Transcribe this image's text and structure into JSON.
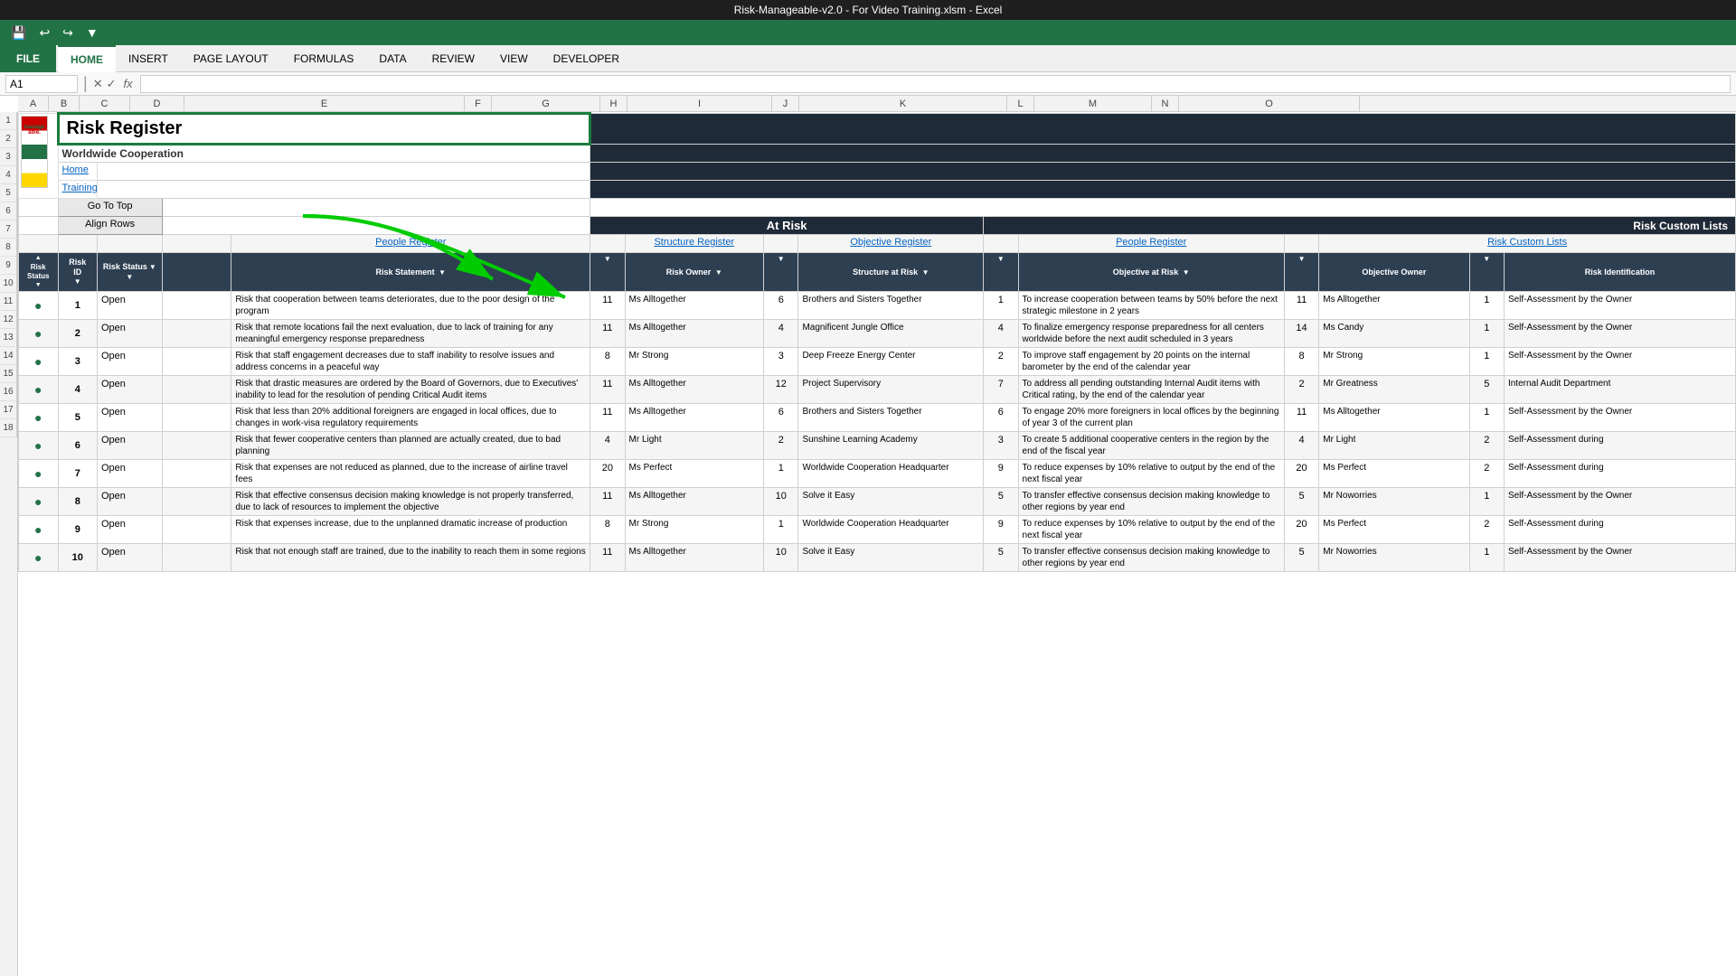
{
  "titleBar": {
    "text": "Risk-Manageable-v2.0 - For Video Training.xlsm - Excel"
  },
  "ribbon": {
    "tabs": [
      "FILE",
      "HOME",
      "INSERT",
      "PAGE LAYOUT",
      "FORMULAS",
      "DATA",
      "REVIEW",
      "VIEW",
      "DEVELOPER"
    ],
    "activeTab": "HOME"
  },
  "formulaBar": {
    "cellRef": "A1",
    "fx": "fx"
  },
  "colHeaders": [
    "A",
    "B",
    "C",
    "D",
    "E",
    "F",
    "G",
    "H",
    "I",
    "J",
    "K",
    "L",
    "M",
    "N",
    "O"
  ],
  "spreadsheet": {
    "header": {
      "title": "Risk Register",
      "subtitle": "Worldwide Cooperation",
      "homeLink": "Home",
      "trainingLink": "Training"
    },
    "buttons": {
      "goToTop": "Go To Top",
      "alignRows": "Align Rows"
    },
    "atRiskHeader": "At Risk",
    "riskCustomLists": "Risk Custom Lists",
    "links": {
      "peopleRegister1": "People Register",
      "structureRegister": "Structure Register",
      "objectiveRegister": "Objective Register",
      "peopleRegister2": "People Register",
      "riskCustomLists": "Risk Custom Lists"
    },
    "columnHeaders": {
      "riskStatus": "Risk Status",
      "riskId": "Risk ID",
      "riskStatement": "Risk Statement",
      "riskOwner": "Risk Owner",
      "structureAtRisk": "Structure at Risk",
      "objectiveAtRisk": "Objective at Risk",
      "objectiveOwner": "Objective Owner",
      "riskIdentification": "Risk Identification"
    },
    "rows": [
      {
        "id": 1,
        "status": "Open",
        "statusIndicator": "●",
        "riskStatement": "Risk that cooperation between teams deteriorates, due to the poor design of the program",
        "ownerNum": 11,
        "owner": "Ms Alltogether",
        "structureNum": 6,
        "structure": "Brothers and Sisters Together",
        "objectiveNum": 1,
        "objective": "To increase cooperation between teams by 50% before the next strategic milestone in 2 years",
        "objectiveOwnerNum": 11,
        "objectiveOwner": "Ms Alltogether",
        "identificationNum": 1,
        "identification": "Self-Assessment by the Owner"
      },
      {
        "id": 2,
        "status": "Open",
        "statusIndicator": "●",
        "riskStatement": "Risk that remote locations fail the next evaluation, due to lack of training for any meaningful emergency response preparedness",
        "ownerNum": 11,
        "owner": "Ms Alltogether",
        "structureNum": 4,
        "structure": "Magnificent Jungle Office",
        "objectiveNum": 4,
        "objective": "To finalize emergency response preparedness for all centers worldwide before the next audit scheduled in 3 years",
        "objectiveOwnerNum": 14,
        "objectiveOwner": "Ms Candy",
        "identificationNum": 1,
        "identification": "Self-Assessment by the Owner"
      },
      {
        "id": 3,
        "status": "Open",
        "statusIndicator": "●",
        "riskStatement": "Risk that staff engagement decreases due to staff inability to resolve issues and address concerns in a peaceful way",
        "ownerNum": 8,
        "owner": "Mr Strong",
        "structureNum": 3,
        "structure": "Deep Freeze Energy Center",
        "objectiveNum": 2,
        "objective": "To improve staff engagement by 20 points on the internal barometer by the end of the calendar year",
        "objectiveOwnerNum": 8,
        "objectiveOwner": "Mr Strong",
        "identificationNum": 1,
        "identification": "Self-Assessment by the Owner"
      },
      {
        "id": 4,
        "status": "Open",
        "statusIndicator": "●",
        "riskStatement": "Risk that drastic measures are ordered by the Board of Governors, due to Executives' inability to lead for the resolution of pending Critical Audit items",
        "ownerNum": 11,
        "owner": "Ms Alltogether",
        "structureNum": 12,
        "structure": "Project Supervisory",
        "objectiveNum": 7,
        "objective": "To address all pending outstanding Internal Audit items with Critical rating, by the end of the calendar year",
        "objectiveOwnerNum": 2,
        "objectiveOwner": "Mr Greatness",
        "identificationNum": 5,
        "identification": "Internal Audit Department"
      },
      {
        "id": 5,
        "status": "Open",
        "statusIndicator": "●",
        "riskStatement": "Risk that less than 20% additional foreigners are engaged in local offices, due to changes in work-visa regulatory requirements",
        "ownerNum": 11,
        "owner": "Ms Alltogether",
        "structureNum": 6,
        "structure": "Brothers and Sisters Together",
        "objectiveNum": 6,
        "objective": "To engage 20% more foreigners in local offices by the beginning of year 3 of the current plan",
        "objectiveOwnerNum": 11,
        "objectiveOwner": "Ms Alltogether",
        "identificationNum": 1,
        "identification": "Self-Assessment by the Owner"
      },
      {
        "id": 6,
        "status": "Open",
        "statusIndicator": "●",
        "riskStatement": "Risk that fewer cooperative centers than planned are actually created, due to bad planning",
        "ownerNum": 4,
        "owner": "Mr Light",
        "structureNum": 2,
        "structure": "Sunshine Learning Academy",
        "objectiveNum": 3,
        "objective": "To create 5 additional cooperative centers in the region by the end of the fiscal year",
        "objectiveOwnerNum": 4,
        "objectiveOwner": "Mr Light",
        "identificationNum": 2,
        "identification": "Self-Assessment during"
      },
      {
        "id": 7,
        "status": "Open",
        "statusIndicator": "●",
        "riskStatement": "Risk that expenses are not reduced as planned, due to the increase of airline travel fees",
        "ownerNum": 20,
        "owner": "Ms Perfect",
        "structureNum": 1,
        "structure": "Worldwide Cooperation Headquarter",
        "objectiveNum": 9,
        "objective": "To reduce expenses by 10% relative to output by the end of the next fiscal year",
        "objectiveOwnerNum": 20,
        "objectiveOwner": "Ms Perfect",
        "identificationNum": 2,
        "identification": "Self-Assessment during"
      },
      {
        "id": 8,
        "status": "Open",
        "statusIndicator": "●",
        "riskStatement": "Risk that effective consensus decision making knowledge is not properly transferred, due to lack of resources to implement the objective",
        "ownerNum": 11,
        "owner": "Ms Alltogether",
        "structureNum": 10,
        "structure": "Solve it Easy",
        "objectiveNum": 5,
        "objective": "To transfer effective consensus decision making knowledge to other regions by year end",
        "objectiveOwnerNum": 5,
        "objectiveOwner": "Mr Noworries",
        "identificationNum": 1,
        "identification": "Self-Assessment by the Owner"
      },
      {
        "id": 9,
        "status": "Open",
        "statusIndicator": "●",
        "riskStatement": "Risk that expenses increase, due to the unplanned dramatic increase of production",
        "ownerNum": 8,
        "owner": "Mr Strong",
        "structureNum": 1,
        "structure": "Worldwide Cooperation Headquarter",
        "objectiveNum": 9,
        "objective": "To reduce expenses by 10% relative to output by the end of the next fiscal year",
        "objectiveOwnerNum": 20,
        "objectiveOwner": "Ms Perfect",
        "identificationNum": 2,
        "identification": "Self-Assessment during"
      },
      {
        "id": 10,
        "status": "Open",
        "statusIndicator": "●",
        "riskStatement": "Risk that not enough staff are trained, due to the inability to reach them in some regions",
        "ownerNum": 11,
        "owner": "Ms Alltogether",
        "structureNum": 10,
        "structure": "Solve it Easy",
        "objectiveNum": 5,
        "objective": "To transfer effective consensus decision making knowledge to other regions by year end",
        "objectiveOwnerNum": 5,
        "objectiveOwner": "Mr Noworries",
        "identificationNum": 1,
        "identification": "Self-Assessment by the Owner"
      }
    ]
  }
}
